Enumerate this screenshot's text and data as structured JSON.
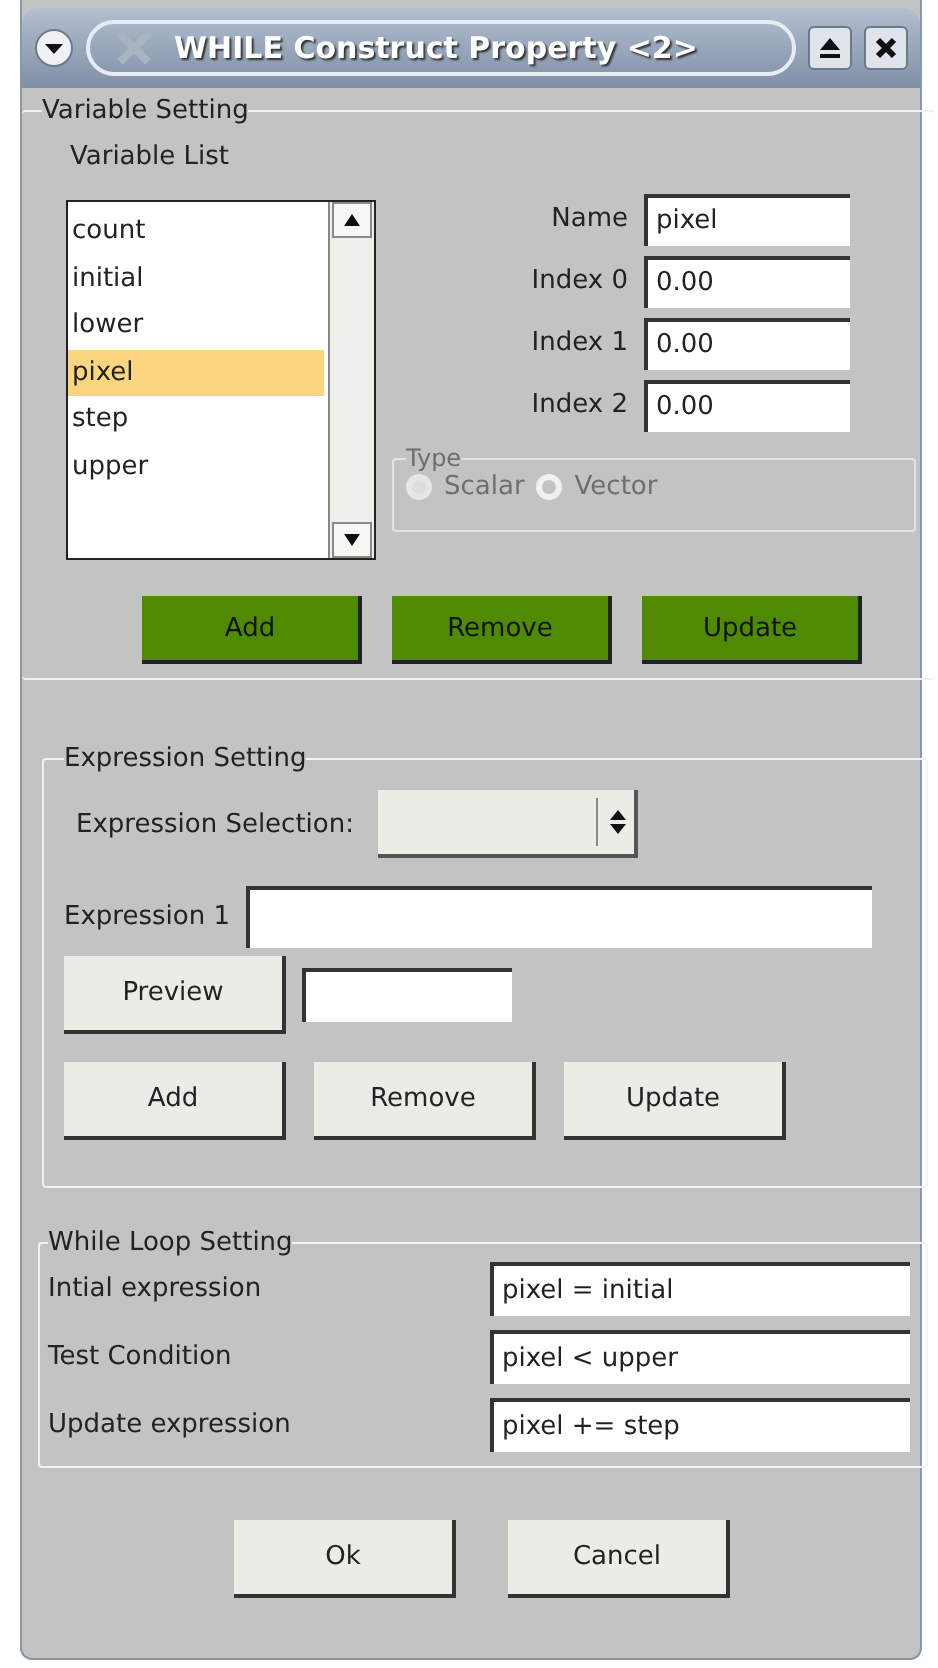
{
  "window": {
    "title": "WHILE Construct Property <2>"
  },
  "variable_setting": {
    "title": "Variable Setting",
    "list_label": "Variable List",
    "variables": [
      {
        "label": "count",
        "selected": false
      },
      {
        "label": "initial",
        "selected": false
      },
      {
        "label": "lower",
        "selected": false
      },
      {
        "label": "pixel",
        "selected": true
      },
      {
        "label": "step",
        "selected": false
      },
      {
        "label": "upper",
        "selected": false
      }
    ],
    "fields": [
      {
        "label": "Name",
        "value": "pixel"
      },
      {
        "label": "Index 0",
        "value": "0.00"
      },
      {
        "label": "Index 1",
        "value": "0.00"
      },
      {
        "label": "Index 2",
        "value": "0.00"
      }
    ],
    "type_group": {
      "title": "Type",
      "disabled": true,
      "options": [
        {
          "label": "Scalar",
          "selected": true
        },
        {
          "label": "Vector",
          "selected": false
        }
      ]
    },
    "buttons": [
      "Add",
      "Remove",
      "Update"
    ]
  },
  "expression_setting": {
    "title": "Expression Setting",
    "selection_label": "Expression Selection:",
    "expression_label": "Expression 1",
    "preview_button": "Preview",
    "buttons": [
      "Add",
      "Remove",
      "Update"
    ]
  },
  "while_loop_setting": {
    "title": "While Loop Setting",
    "rows": [
      {
        "label": "Intial expression",
        "value": "pixel = initial"
      },
      {
        "label": "Test Condition",
        "value": "pixel < upper"
      },
      {
        "label": "Update expression",
        "value": "pixel += step"
      }
    ]
  },
  "dialog_buttons": [
    "Ok",
    "Cancel"
  ]
}
